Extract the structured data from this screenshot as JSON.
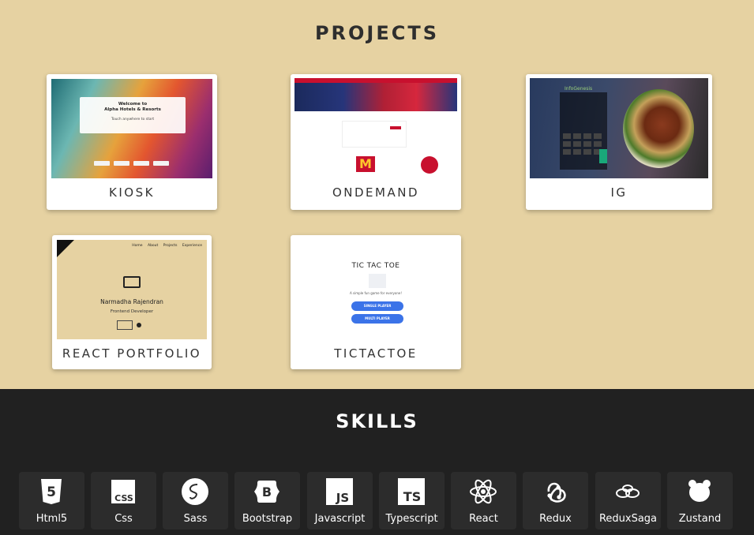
{
  "projects": {
    "title": "PROJECTS",
    "cards": [
      {
        "label": "KIOSK",
        "preview": {
          "welcome": "Welcome to",
          "brand": "Alpha Hotels & Resorts",
          "hint": "Touch anywhere to start"
        }
      },
      {
        "label": "ONDEMAND"
      },
      {
        "label": "IG",
        "preview": {
          "brand": "InfoGenesis"
        }
      },
      {
        "label": "REACT PORTFOLIO",
        "preview": {
          "nav": "Home About Projects Experience",
          "name": "Narmadha Rajendran",
          "role": "Frontend Developer"
        }
      },
      {
        "label": "TICTACTOE",
        "preview": {
          "title": "TIC TAC TOE",
          "subtitle": "A simple fun game for everyone!",
          "single": "SINGLE PLAYER",
          "multi": "MULTI PLAYER"
        }
      }
    ]
  },
  "skills": {
    "title": "SKILLS",
    "items": [
      {
        "label": "Html5",
        "icon": "html5-icon"
      },
      {
        "label": "Css",
        "icon": "css-icon"
      },
      {
        "label": "Sass",
        "icon": "sass-icon"
      },
      {
        "label": "Bootstrap",
        "icon": "bootstrap-icon"
      },
      {
        "label": "Javascript",
        "icon": "javascript-icon"
      },
      {
        "label": "Typescript",
        "icon": "typescript-icon"
      },
      {
        "label": "React",
        "icon": "react-icon"
      },
      {
        "label": "Redux",
        "icon": "redux-icon"
      },
      {
        "label": "ReduxSaga",
        "icon": "redux-saga-icon"
      },
      {
        "label": "Zustand",
        "icon": "zustand-icon"
      }
    ]
  },
  "colors": {
    "projects_bg": "#e6d2a2",
    "skills_bg": "#212121",
    "skill_tile_bg": "#2c2c2c",
    "heading_dark": "#2e2e2e"
  }
}
